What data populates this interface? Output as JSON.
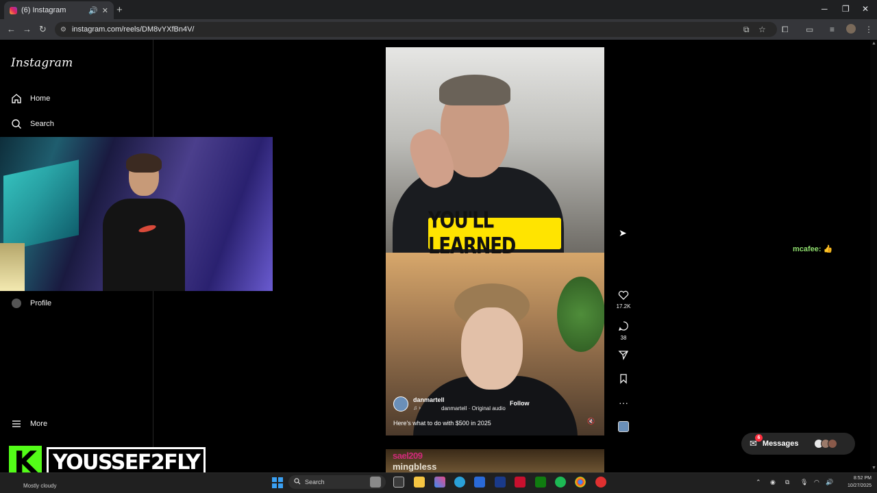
{
  "browser": {
    "tab_title": "(6) Instagram",
    "new_tab_icon": "plus-icon",
    "url": "instagram.com/reels/DM8vYXfBn4V/",
    "window_controls": [
      "─",
      "❐",
      "✕"
    ]
  },
  "sidebar": {
    "logo": "Instagram",
    "items": [
      {
        "label": "Home",
        "icon": "home-icon"
      },
      {
        "label": "Search",
        "icon": "search-icon"
      },
      {
        "label": "Profile",
        "icon": "profile-avatar"
      },
      {
        "label": "More",
        "icon": "menu-icon"
      }
    ]
  },
  "reel": {
    "caption_overlay": "YOU'LL LEARNED",
    "author": "danmartell",
    "audio": "danmartell · Original audio",
    "follow_label": "Follow",
    "description": "Here's what to do with $500 in 2025",
    "likes": "17.2K",
    "comments": "38",
    "next_reel_text_1": "sael209",
    "next_reel_text_2": "mingbless"
  },
  "chat": {
    "user": "mcafee:",
    "emoji": "👍"
  },
  "messages": {
    "label": "Messages",
    "badge": "6"
  },
  "brand": {
    "initial": "K",
    "name": "YOUSSEF2FLY"
  },
  "taskbar": {
    "weather": "Mostly cloudy",
    "search_placeholder": "Search",
    "time": "8:52 PM",
    "date": "10/27/2025"
  },
  "colors": {
    "caption_bg": "#ffe400",
    "chat_user": "#90e06f",
    "brand_green": "#53fc18",
    "badge_red": "#ff3040"
  }
}
